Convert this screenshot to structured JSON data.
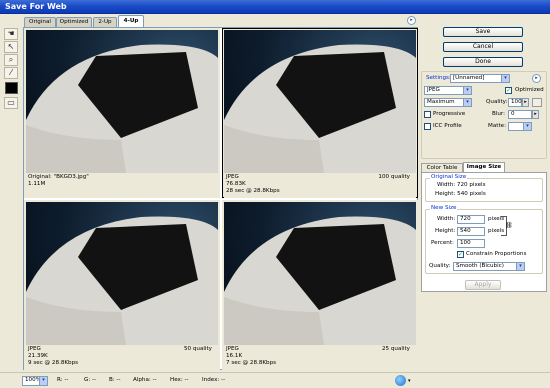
{
  "window": {
    "title": "Save For Web"
  },
  "tabs": [
    "Original",
    "Optimized",
    "2-Up",
    "4-Up"
  ],
  "tools": [
    {
      "name": "hand-icon",
      "glyph": "✋"
    },
    {
      "name": "slice-select-icon",
      "glyph": "⟋"
    },
    {
      "name": "zoom-icon",
      "glyph": "🔍"
    },
    {
      "name": "eyedropper-icon",
      "glyph": "⁄"
    }
  ],
  "panes": [
    {
      "line1": "Original: \"BKGD3.jpg\"",
      "line2": "1.11M",
      "line3": "",
      "quality": ""
    },
    {
      "line1": "JPEG",
      "line2": "76.83K",
      "line3": "28 sec @ 28.8Kbps",
      "quality": "100 quality"
    },
    {
      "line1": "JPEG",
      "line2": "21.39K",
      "line3": "9 sec @ 28.8Kbps",
      "quality": "50 quality"
    },
    {
      "line1": "JPEG",
      "line2": "16.1K",
      "line3": "7 sec @ 28.8Kbps",
      "quality": "25 quality"
    }
  ],
  "buttons": {
    "save": "Save",
    "cancel": "Cancel",
    "done": "Done",
    "apply": "Apply"
  },
  "settings": {
    "label": "Settings:",
    "preset": "[Unnamed]",
    "format": "JPEG",
    "quality_preset": "Maximum",
    "optimized_label": "Optimized",
    "optimized": true,
    "quality_label": "Quality:",
    "quality": "100",
    "progressive_label": "Progressive",
    "blur_label": "Blur:",
    "blur": "0",
    "icc_label": "ICC Profile",
    "matte_label": "Matte:"
  },
  "panel_tabs": [
    "Color Table",
    "Image Size"
  ],
  "image_size": {
    "original_label": "Original Size",
    "orig_width": "Width:  720 pixels",
    "orig_height": "Height:  540 pixels",
    "new_label": "New Size",
    "width_label": "Width:",
    "width": "720",
    "height_label": "Height:",
    "height": "540",
    "unit": "pixels",
    "percent_label": "Percent:",
    "percent": "100",
    "constrain_label": "Constrain Proportions",
    "constrain": true,
    "quality_label": "Quality:",
    "quality": "Smooth (Bicubic)"
  },
  "statusbar": {
    "zoom": "100%",
    "r": "R:  --",
    "g": "G:  --",
    "b": "B:  --",
    "alpha": "Alpha:  --",
    "hex": "Hex:  --",
    "index": "Index:  --"
  }
}
